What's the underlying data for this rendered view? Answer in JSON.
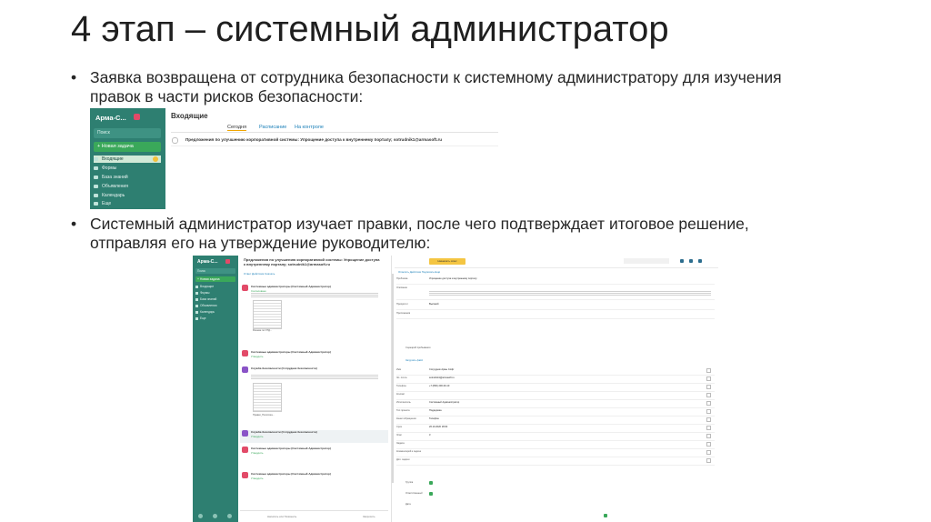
{
  "slide": {
    "title": "4 этап – системный администратор",
    "bullets": [
      {
        "lines": [
          "Заявка возвращена от сотрудника безопасности к системному администратору для изучения",
          "правок в части рисков безопасности:"
        ]
      },
      {
        "lines": [
          "Системный администратор изучает правки, после чего подтверждает итоговое решение,",
          "отправляя его на утверждение руководителю:"
        ]
      }
    ],
    "bullet_glyph": "•"
  },
  "shot1": {
    "sidebar": {
      "app_name": "Арма-С...",
      "search_placeholder": "Поиск",
      "new_task": "+ Новая задача",
      "items": [
        "Входящие",
        "Формы",
        "База знаний",
        "Объявления",
        "Календарь",
        "Еще"
      ],
      "active_index": 0
    },
    "main": {
      "title": "Входящие",
      "tabs": [
        "Сегодня",
        "Расписание",
        "На контроле"
      ],
      "row_text": "Предложения по улучшению корпоративной системы: Упрощение доступа к внутреннему порталу; sotrudnik1@armasoft.ru"
    },
    "colors": {
      "sidebar": "#2e7f71",
      "new_task": "#3aa85a",
      "badge": "#e24a68",
      "active_tab": "#f0a500"
    }
  },
  "shot2": {
    "sidebar": {
      "app_name": "Арма-С...",
      "search_placeholder": "Поиск",
      "new_task": "+ Новая задача",
      "items": [
        "Входящие",
        "Формы",
        "База знаний",
        "Объявления",
        "Календарь",
        "Еще"
      ]
    },
    "list": {
      "header": "Предложения по улучшению корпоративной системы: Упрощение доступа к внутреннему порталу; sotrudnik1@armasoft.ru",
      "tabs": "Ответ   Действия   Скачать",
      "messages": [
        {
          "author": "Системные администраторы (Системный Администратор)",
          "status": "Согласовано",
          "has_doc": true,
          "caption": "Резюме по ОТД...",
          "selected": false
        },
        {
          "author": "Системные администраторы (Системный Администратор)",
          "status": "Утвердить",
          "has_doc": false,
          "caption": "",
          "selected": false
        },
        {
          "author": "Служба безопасности (Сотрудник безопасности)",
          "status": "",
          "has_doc": true,
          "caption": "Правки_Политика...",
          "selected": false
        },
        {
          "author": "Служба безопасности (Сотрудник безопасности)",
          "status": "Утвердить",
          "has_doc": false,
          "caption": "",
          "selected": true
        },
        {
          "author": "Системные администраторы (Системный Администратор)",
          "status": "Утвердить",
          "has_doc": false,
          "caption": "",
          "selected": false
        },
        {
          "author": "Системные администраторы (Системный Администратор)",
          "status": "Утвердить",
          "has_doc": false,
          "caption": "",
          "selected": false
        }
      ],
      "bottom_left": "Написать или Позвонить",
      "bottom_right": "Запросить"
    },
    "form": {
      "top_button": "Назначить ответ",
      "actions": "Ответить   Действия   Подписать   Ещё",
      "fields": [
        {
          "label": "Проблема",
          "value": "Упрощение доступа к внутреннему порталу"
        },
        {
          "label": "Описание",
          "value": ""
        },
        {
          "label": "Приоритет",
          "value": "Высокий"
        },
        {
          "label": "Приложения",
          "value": ""
        }
      ],
      "file_label": "Сценарий пребывания",
      "upload_label": "Загрузить файл",
      "contact_fields": [
        {
          "label": "Имя",
          "value": "Сотрудник Армы Софт"
        },
        {
          "label": "Эл. почта",
          "value": "sotrudnik1@armasoft.ru"
        },
        {
          "label": "Телефон",
          "value": "+7 (800) 200-30-10"
        },
        {
          "label": "Контакт",
          "value": ""
        },
        {
          "label": "Исполнитель",
          "value": "Системный Администратор"
        },
        {
          "label": "Тип проекта",
          "value": "Поддержка"
        },
        {
          "label": "Канал обращения",
          "value": "Телефон"
        },
        {
          "label": "Срок",
          "value": "26.10.2020 18:00"
        },
        {
          "label": "Этап",
          "value": "3"
        },
        {
          "label": "Задача",
          "value": ""
        },
        {
          "label": "Комментарий к задаче",
          "value": ""
        },
        {
          "label": "Доп. задачи",
          "value": ""
        }
      ],
      "extra": [
        "Группа",
        "Ответственный",
        "Дата"
      ]
    },
    "colors": {
      "sidebar": "#2e7f71",
      "button": "#f4c542",
      "accent": "#1a7fb8"
    }
  }
}
